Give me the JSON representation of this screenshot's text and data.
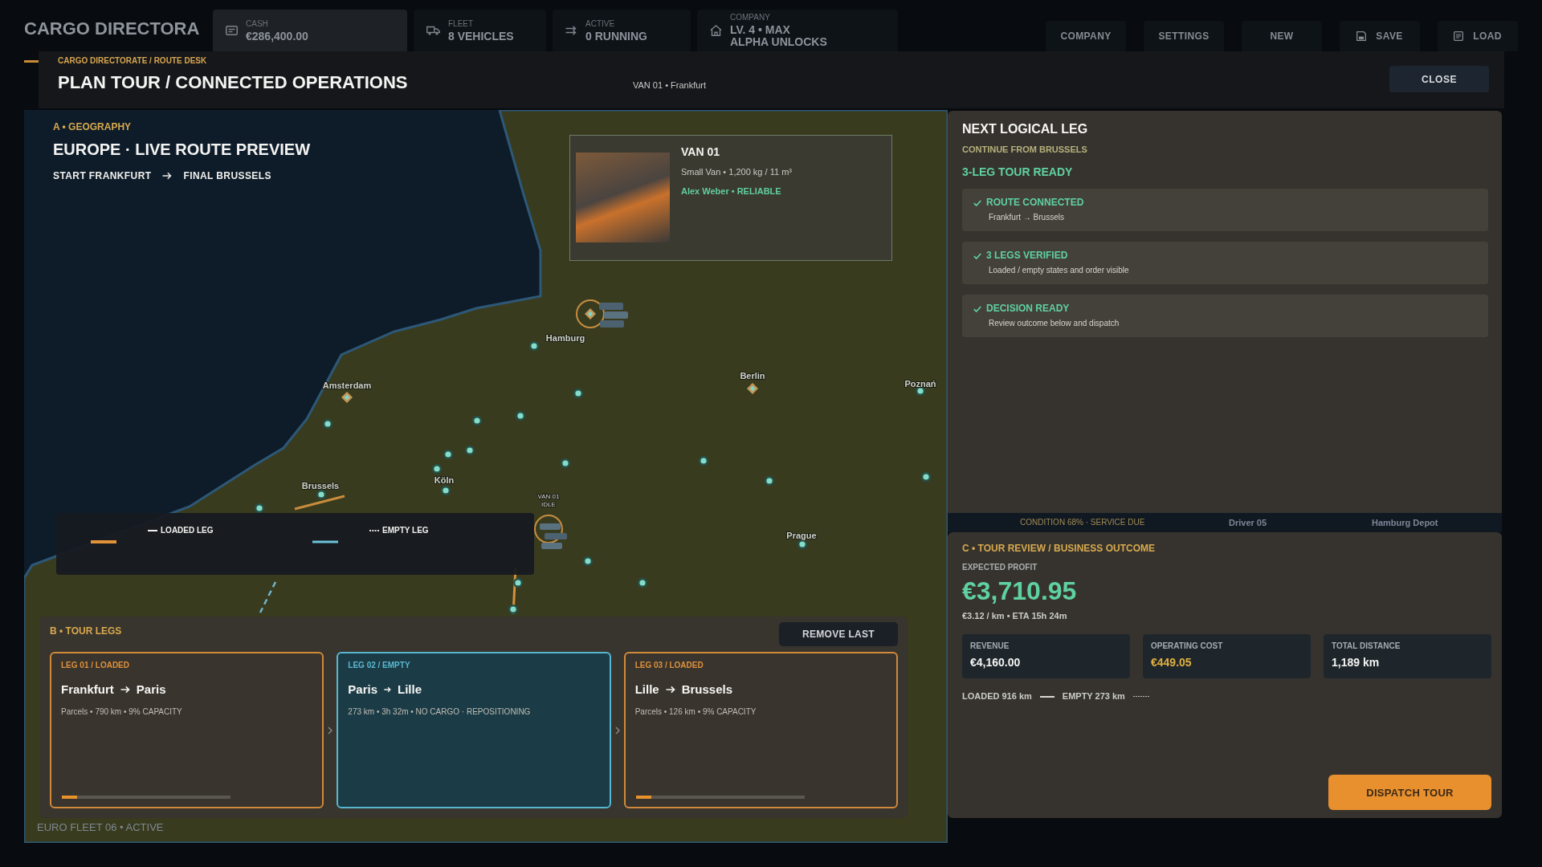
{
  "background_app": {
    "title": "CARGO DIRECTORA",
    "stats": [
      {
        "kind": "cash",
        "label": "CASH",
        "value": "€286,400.00",
        "selected": true
      },
      {
        "kind": "fleet",
        "label": "FLEET",
        "value": "8 VEHICLES",
        "selected": false
      },
      {
        "kind": "active",
        "label": "ACTIVE",
        "value": "0 RUNNING",
        "selected": false
      },
      {
        "kind": "company",
        "label": "COMPANY",
        "value": "LV. 4 • MAX ALPHA UNLOCKS",
        "selected": false
      }
    ],
    "nav": [
      {
        "kind": "plain",
        "label": "COMPANY"
      },
      {
        "kind": "plain",
        "label": "SETTINGS"
      },
      {
        "kind": "plain",
        "label": "NEW"
      },
      {
        "kind": "save",
        "label": "SAVE"
      },
      {
        "kind": "load",
        "label": "LOAD"
      }
    ]
  },
  "modal": {
    "breadcrumb": "CARGO DIRECTORATE / ROUTE DESK",
    "title": "PLAN TOUR / CONNECTED OPERATIONS",
    "context": "VAN 01 • Frankfurt",
    "close_button": "CLOSE"
  },
  "map": {
    "section": "A • GEOGRAPHY",
    "title": "EUROPE · LIVE ROUTE PREVIEW",
    "route_start": "START FRANKFURT",
    "route_end": "FINAL BRUSSELS",
    "city_labels": [
      "Hamburg",
      "Amsterdam",
      "Berlin",
      "Poznań",
      "Brussels",
      "Köln",
      "Prague"
    ],
    "vehicle_label": "VAN 01",
    "vehicle_status": "IDLE",
    "legend": [
      {
        "kind": "loaded",
        "label": "LOADED LEG"
      },
      {
        "kind": "empty",
        "label": "EMPTY LEG"
      }
    ],
    "status": "EURO FLEET 06 • ACTIVE"
  },
  "vehicle_card": {
    "name": "VAN 01",
    "specs": "Small Van • 1,200 kg / 11 m³",
    "driver": "Alex Weber • RELIABLE"
  },
  "tour_legs": {
    "section": "B • TOUR LEGS",
    "remove_button": "REMOVE LAST",
    "legs": [
      {
        "kind": "loaded",
        "tag": "LEG 01 / LOADED",
        "from": "Frankfurt",
        "to": "Paris",
        "details": "Parcels • 790 km • 9% CAPACITY",
        "level": 0.09
      },
      {
        "kind": "empty",
        "tag": "LEG 02 / EMPTY",
        "from": "Paris",
        "to": "Lille",
        "details": "273 km • 3h 32m • NO CARGO · REPOSITIONING"
      },
      {
        "kind": "loaded",
        "tag": "LEG 03 / LOADED",
        "from": "Lille",
        "to": "Brussels",
        "details": "Parcels • 126 km • 9% CAPACITY",
        "level": 0.09
      }
    ]
  },
  "next_leg": {
    "title": "NEXT LOGICAL LEG",
    "continue_from": "CONTINUE FROM BRUSSELS",
    "status": "3-LEG TOUR READY",
    "checks": [
      {
        "title": "ROUTE CONNECTED",
        "detail": "Frankfurt → Brussels",
        "checked": true
      },
      {
        "title": "3 LEGS VERIFIED",
        "detail": "Loaded / empty states and order visible",
        "checked": true
      },
      {
        "title": "DECISION READY",
        "detail": "Review outcome below and dispatch",
        "checked": true
      }
    ]
  },
  "vehicle_strip": {
    "condition": "CONDITION 68% · SERVICE DUE",
    "driver": "Driver 05",
    "depot": "Hamburg Depot"
  },
  "review": {
    "section": "C • TOUR REVIEW / BUSINESS OUTCOME",
    "profit_label": "EXPECTED PROFIT",
    "profit": "€3,710.95",
    "summary": "€3.12 / km • ETA 15h 24m",
    "metrics": [
      {
        "kind": "income",
        "label": "REVENUE",
        "value": "€4,160.00"
      },
      {
        "kind": "cost",
        "label": "OPERATING COST",
        "value": "€449.05"
      },
      {
        "kind": "distance",
        "label": "TOTAL DISTANCE",
        "value": "1,189 km"
      }
    ],
    "distance_split": [
      {
        "kind": "loaded",
        "label": "LOADED 916 km"
      },
      {
        "kind": "empty",
        "label": "EMPTY 273 km"
      }
    ],
    "dispatch_button": "DISPATCH TOUR"
  }
}
